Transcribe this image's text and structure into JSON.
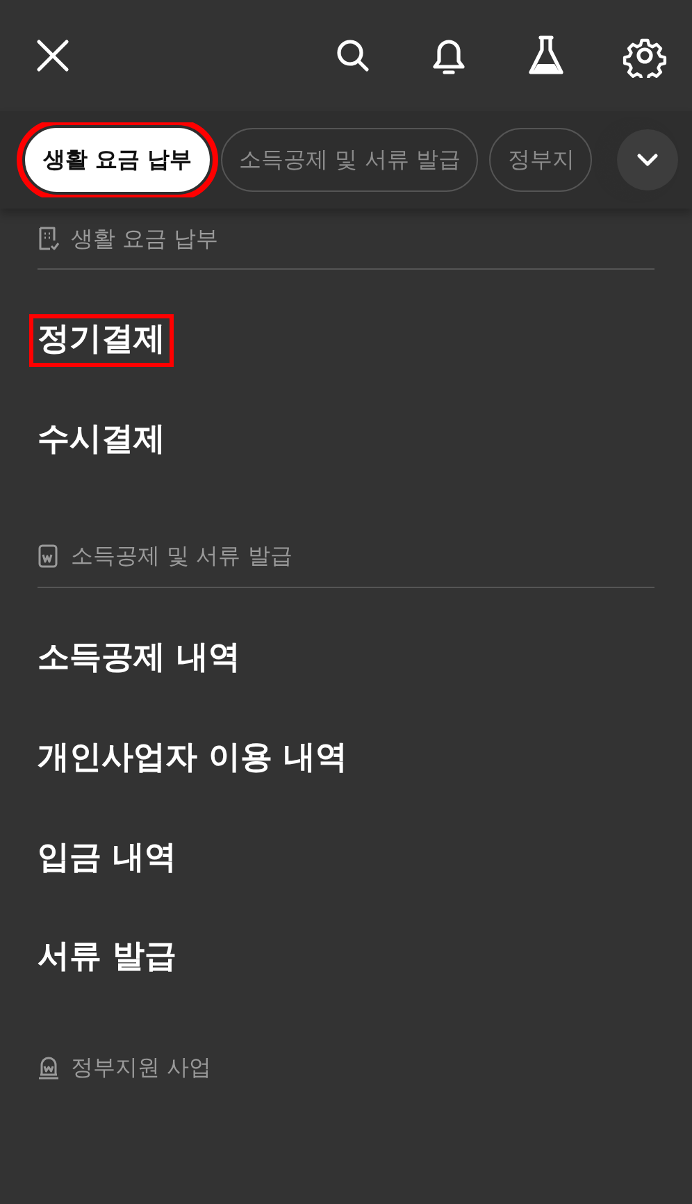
{
  "top_bar": {
    "actions": [
      {
        "kind": "search"
      },
      {
        "kind": "bell"
      },
      {
        "kind": "flask"
      },
      {
        "kind": "settings"
      }
    ]
  },
  "chips": [
    {
      "label": "생활 요금 납부",
      "selected": true,
      "highlighted": true
    },
    {
      "label": "소득공제 및 서류 발급",
      "selected": false,
      "highlighted": false
    },
    {
      "label": "정부지",
      "selected": false,
      "highlighted": false
    }
  ],
  "sections": [
    {
      "title": "생활 요금 납부",
      "kind": "receipt",
      "items": [
        {
          "label": "정기결제",
          "highlighted": true
        },
        {
          "label": "수시결제",
          "highlighted": false
        }
      ]
    },
    {
      "title": "소득공제 및 서류 발급",
      "kind": "document",
      "items": [
        {
          "label": "소득공제 내역",
          "highlighted": false
        },
        {
          "label": "개인사업자 이용 내역",
          "highlighted": false
        },
        {
          "label": "입금 내역",
          "highlighted": false
        },
        {
          "label": "서류 발급",
          "highlighted": false
        }
      ]
    },
    {
      "title": "정부지원 사업",
      "kind": "monument"
    }
  ]
}
